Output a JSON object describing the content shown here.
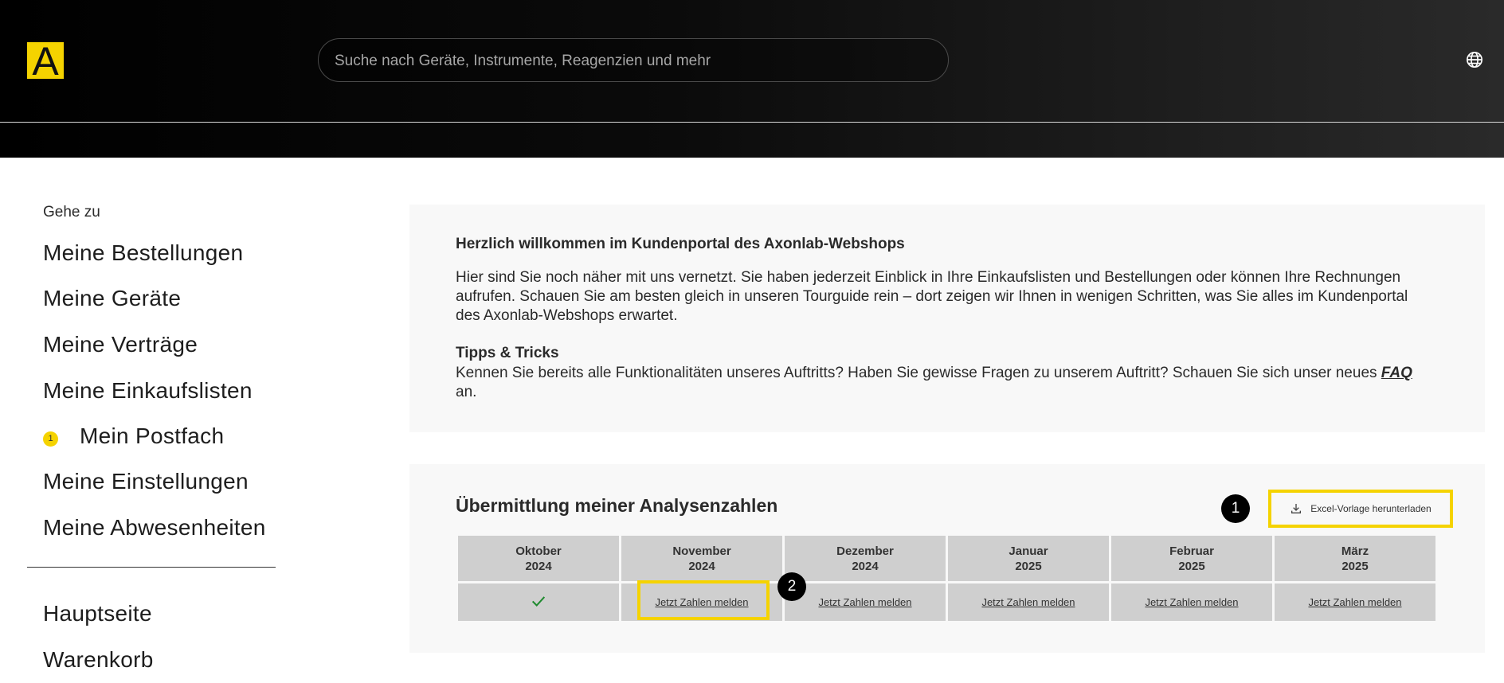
{
  "header": {
    "logo_letter": "A",
    "search_placeholder": "Suche nach Geräte, Instrumente, Reagenzien und mehr",
    "language_icon": "globe-icon"
  },
  "sidebar": {
    "goto_label": "Gehe zu",
    "items": [
      {
        "label": "Meine Bestellungen"
      },
      {
        "label": "Meine Geräte"
      },
      {
        "label": "Meine Verträge"
      },
      {
        "label": "Meine Einkaufslisten"
      },
      {
        "label": "Mein Postfach",
        "badge": "1"
      },
      {
        "label": "Meine Einstellungen"
      },
      {
        "label": "Meine Abwesenheiten"
      }
    ],
    "secondary_items": [
      {
        "label": "Hauptseite"
      },
      {
        "label": "Warenkorb"
      }
    ]
  },
  "welcome": {
    "title": "Herzlich willkommen im Kundenportal des Axonlab-Webshops",
    "body": "Hier sind Sie noch näher mit uns vernetzt. Sie haben jederzeit Einblick in Ihre Einkaufslisten und Bestellungen oder können Ihre Rechnungen aufrufen. Schauen Sie am besten gleich in unseren Tourguide rein – dort zeigen wir Ihnen in wenigen Schritten, was Sie alles im Kundenportal des Axonlab-Webshops erwartet.",
    "tips_title": "Tipps & Tricks",
    "tips_body_before": "Kennen Sie bereits alle Funktionalitäten unseres Auftritts? Haben Sie gewisse Fragen zu unserem Auftritt? Schauen Sie sich unser neues ",
    "tips_link": "FAQ",
    "tips_body_after": " an."
  },
  "analysis": {
    "title": "Übermittlung meiner Analysenzahlen",
    "download_button": "Excel-Vorlage herunterladen",
    "marker_1": "1",
    "marker_2": "2",
    "months": [
      {
        "month": "Oktober",
        "year": "2024",
        "status": "done",
        "check": "✓"
      },
      {
        "month": "November",
        "year": "2024",
        "action": "Jetzt Zahlen melden"
      },
      {
        "month": "Dezember",
        "year": "2024",
        "action": "Jetzt Zahlen melden"
      },
      {
        "month": "Januar",
        "year": "2025",
        "action": "Jetzt Zahlen melden"
      },
      {
        "month": "Februar",
        "year": "2025",
        "action": "Jetzt Zahlen melden"
      },
      {
        "month": "März",
        "year": "2025",
        "action": "Jetzt Zahlen melden"
      }
    ]
  },
  "colors": {
    "accent_yellow": "#f5d300",
    "check_green": "#1e8a2e"
  }
}
